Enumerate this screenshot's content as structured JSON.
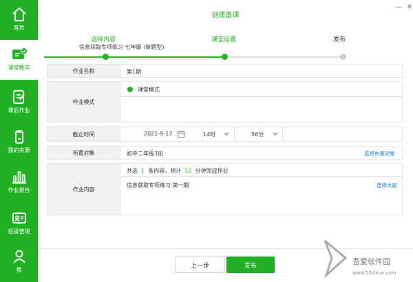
{
  "sidebar": {
    "items": [
      {
        "label": "首页",
        "icon": "home-icon"
      },
      {
        "label": "课堂教学",
        "icon": "classroom-icon"
      },
      {
        "label": "课后作业",
        "icon": "homework-icon"
      },
      {
        "label": "我的资源",
        "icon": "resource-icon"
      },
      {
        "label": "作业报告",
        "icon": "report-icon"
      },
      {
        "label": "班级管理",
        "icon": "class-management-icon"
      },
      {
        "label": "我",
        "icon": "user-icon"
      }
    ]
  },
  "header": {
    "title": "创建备课",
    "minimize_icon": "minimize-icon",
    "close_icon": "close-icon"
  },
  "steps": [
    {
      "label": "选择内容",
      "sub": "信息获取专项练习 七年级 (新题型)",
      "state": "done"
    },
    {
      "label": "课堂设置",
      "state": "current"
    },
    {
      "label": "发布",
      "state": "pending"
    }
  ],
  "form": {
    "name": {
      "label": "作业名称",
      "value": "第1期"
    },
    "mode": {
      "label": "作业模式",
      "value": "课堂模式"
    },
    "deadline": {
      "label": "截止时间",
      "date": "2021-9-17",
      "hour": "14时",
      "minute": "56分"
    },
    "target": {
      "label": "布置对象",
      "value": "初中二年级3班",
      "action": "选择布置对象"
    },
    "content": {
      "label": "作业内容",
      "summary_prefix": "共选",
      "count": "1",
      "summary_mid": "条内容，预计",
      "minutes": "12",
      "summary_suffix": "分钟完成作业",
      "item": "信息获取专项练习 第一期",
      "action": "选择大题"
    }
  },
  "buttons": {
    "prev": "上一步",
    "publish": "发布"
  },
  "watermark": {
    "text": "吾爱软件园",
    "url": "www.52zixue.com"
  },
  "colors": {
    "accent": "#21b023",
    "link": "#1e7be0",
    "label_bg": "#f1f1f1",
    "border": "#e2e2e2"
  }
}
